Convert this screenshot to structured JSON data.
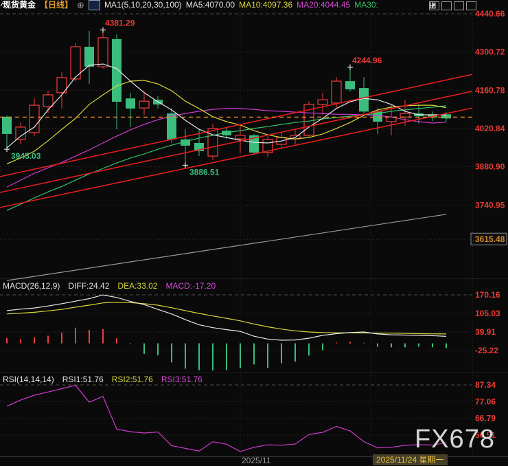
{
  "header": {
    "symbol": "现货黄金",
    "period": "【日线】",
    "ma_settings": "MA1(5,10,20,30,100)",
    "ma_labels": [
      {
        "name": "ma5",
        "text": "MA5:4070.00"
      },
      {
        "name": "ma10",
        "text": "MA10:4097.36"
      },
      {
        "name": "ma20",
        "text": "MA20:4044.45"
      },
      {
        "name": "ma30",
        "text": "MA30:"
      }
    ]
  },
  "macd_panel": {
    "title": "MACD(26,12,9)",
    "diff_label": "DIFF:24.42",
    "dea_label": "DEA:33.02",
    "macd_label": "MACD:-17.20"
  },
  "rsi_panel": {
    "title": "RSI(14,14,14)",
    "rsi1_label": "RSI1:51.76",
    "rsi2_label": "RSI2:51.76",
    "rsi3_label": "RSI3:51.76"
  },
  "watermark": "FX678",
  "colors": {
    "up": "#f23c3c",
    "down": "#3bbd7e",
    "tick": "#ea3b34",
    "ma5": "#e6e6e6",
    "ma10": "#d9d73a",
    "ma20": "#d23ad2",
    "ma30": "#35c06a",
    "ma100": "#9a9a9a",
    "trendline": "#e11d1d",
    "last_price": "#ef8e1f",
    "boxed_tick": "#d08a2e",
    "marker": "#e0e0e0"
  },
  "chart_data": {
    "type": "candlestick",
    "title": "现货黄金 日线 (spot gold daily)",
    "legend_position": "top",
    "grid": true,
    "x_axis": {
      "labels": [
        {
          "text": "2025/11",
          "x": 352,
          "highlight": false
        },
        {
          "text": "2025/11/24 星期一",
          "x": 543,
          "highlight": true
        }
      ],
      "gridlines_x": [
        350,
        540,
        688
      ]
    },
    "main": {
      "y_ticks": [
        "4440.66",
        "4300.72",
        "4160.78",
        "4020.84",
        "3880.90",
        "3740.95"
      ],
      "boxed_tick": "3615.48",
      "last_price": 4062.5,
      "candles": [
        [
          4064,
          4068,
          3945.03,
          4001
        ],
        [
          3981,
          4043,
          3963,
          4026
        ],
        [
          4006,
          4131,
          3993,
          4106
        ],
        [
          4101,
          4159,
          4076,
          4144
        ],
        [
          4152,
          4227,
          4094,
          4207
        ],
        [
          4202,
          4333,
          4194,
          4320
        ],
        [
          4320,
          4378,
          4184,
          4247
        ],
        [
          4247,
          4381.29,
          4240,
          4353
        ],
        [
          4348,
          4365,
          4018,
          4119
        ],
        [
          4131,
          4152,
          4026,
          4094
        ],
        [
          4096,
          4157,
          4069,
          4121
        ],
        [
          4126,
          4139,
          4094,
          4109
        ],
        [
          4076,
          4094,
          3968,
          3981
        ],
        [
          3981,
          4018,
          3886.51,
          3958
        ],
        [
          3968,
          4021,
          3920,
          3938
        ],
        [
          3920,
          4038,
          3905,
          4021
        ],
        [
          4013,
          4026,
          3983,
          3996
        ],
        [
          3983,
          4033,
          3930,
          3996
        ],
        [
          3996,
          4001,
          3925,
          3933
        ],
        [
          3933,
          3993,
          3918,
          3981
        ],
        [
          3963,
          4006,
          3950,
          3988
        ],
        [
          3983,
          4018,
          3963,
          3996
        ],
        [
          3996,
          4121,
          3988,
          4109
        ],
        [
          4109,
          4152,
          4071,
          4126
        ],
        [
          4114,
          4209,
          4097,
          4194
        ],
        [
          4194,
          4244.96,
          4156,
          4164
        ],
        [
          4169,
          4209,
          4076,
          4083
        ],
        [
          4083,
          4097,
          4001,
          4046
        ],
        [
          4046,
          4109,
          3996,
          4063
        ],
        [
          4063,
          4126,
          4031,
          4076
        ],
        [
          4076,
          4109,
          4038,
          4066
        ],
        [
          4073,
          4083,
          4048,
          4061
        ],
        [
          4073,
          4081,
          4046,
          4058
        ]
      ],
      "ma5": [
        3950,
        3993,
        4026,
        4089,
        4144,
        4209,
        4252,
        4257,
        4240,
        4194,
        4152,
        4119,
        4089,
        4051,
        4018,
        3998,
        3988,
        3978,
        3970,
        3968,
        3975,
        3988,
        4026,
        4058,
        4094,
        4119,
        4131,
        4126,
        4109,
        4084,
        4071,
        4071,
        4070
      ],
      "ma10": [
        3892,
        3913,
        3938,
        3976,
        4018,
        4058,
        4109,
        4144,
        4177,
        4194,
        4197,
        4184,
        4159,
        4121,
        4094,
        4064,
        4046,
        4034,
        4013,
        3998,
        3988,
        3983,
        3988,
        4001,
        4021,
        4043,
        4069,
        4089,
        4099,
        4104,
        4106,
        4106,
        4097
      ],
      "ma20": [
        3807,
        3832,
        3857,
        3877,
        3897,
        3920,
        3943,
        3968,
        3993,
        4016,
        4036,
        4053,
        4066,
        4076,
        4084,
        4091,
        4094,
        4094,
        4091,
        4086,
        4084,
        4081,
        4078,
        4076,
        4073,
        4073,
        4071,
        4068,
        4063,
        4053,
        4046,
        4041,
        4044
      ],
      "ma30": [
        3721,
        3744,
        3767,
        3789,
        3809,
        3832,
        3855,
        3875,
        3895,
        3913,
        3928,
        3945,
        3960,
        3973,
        3986,
        3996,
        4006,
        4013,
        4021,
        4028,
        4036,
        4043,
        4048,
        4056,
        4061,
        4066,
        4071,
        4076,
        4084,
        4089,
        4094,
        4099,
        4104
      ],
      "ma100": {
        "x1": 10,
        "p1": 3465,
        "x2": 650,
        "p2": 3707
      },
      "trendlines": [
        {
          "x1": 0,
          "p1": 3845,
          "x2": 688,
          "p2": 4219
        },
        {
          "x1": 0,
          "p1": 3787,
          "x2": 688,
          "p2": 4157
        },
        {
          "x1": 0,
          "p1": 3732,
          "x2": 688,
          "p2": 4096
        }
      ],
      "annotations": [
        {
          "text": "4381.29",
          "candle": 7,
          "side": "high",
          "kind": "up"
        },
        {
          "text": "4244.96",
          "candle": 25,
          "side": "high",
          "kind": "up"
        },
        {
          "text": "3945.03",
          "candle": 0,
          "side": "low",
          "kind": "down"
        },
        {
          "text": "3886.51",
          "candle": 13,
          "side": "low",
          "kind": "down"
        }
      ]
    },
    "macd": {
      "y_ticks": [
        "170.16",
        "105.03",
        "39.91",
        "-25.22"
      ],
      "hist": [
        19,
        15,
        21,
        27,
        38,
        55,
        47,
        50,
        18,
        -2,
        -37,
        -42,
        -67,
        -89,
        -94,
        -95,
        -94,
        -87,
        -74,
        -86,
        -70,
        -64,
        -43,
        -24,
        3,
        6,
        2,
        -12,
        -14,
        -14,
        -12,
        -14,
        -17.2
      ],
      "diff": [
        115,
        120,
        124,
        131,
        139,
        148,
        157,
        170,
        161,
        147,
        136,
        119,
        103,
        83,
        65,
        55,
        48,
        42,
        25,
        15,
        11,
        12,
        18,
        28,
        34,
        38,
        40,
        33,
        30,
        29,
        28,
        27,
        24.4
      ],
      "dea": [
        103,
        106,
        109,
        114,
        119,
        127,
        134,
        142,
        144,
        143,
        139,
        134,
        125,
        115,
        105,
        96,
        88,
        79,
        68,
        58,
        50,
        44,
        40,
        38,
        37,
        37,
        36.5,
        36,
        36,
        35,
        34,
        33.5,
        33
      ]
    },
    "rsi": {
      "y_ticks": [
        "87.34",
        "77.06",
        "66.79",
        "56.51"
      ],
      "rsi3": [
        74.3,
        78,
        81,
        83,
        85,
        87.1,
        76.7,
        80.3,
        60.2,
        58.6,
        57.8,
        58.4,
        50,
        48.3,
        46.7,
        52.4,
        50.9,
        46.4,
        49,
        50.5,
        50.3,
        51,
        56.8,
        58.2,
        61.8,
        59.1,
        52.5,
        48.6,
        49,
        50.2,
        50.6,
        50.4,
        51.8
      ]
    }
  }
}
